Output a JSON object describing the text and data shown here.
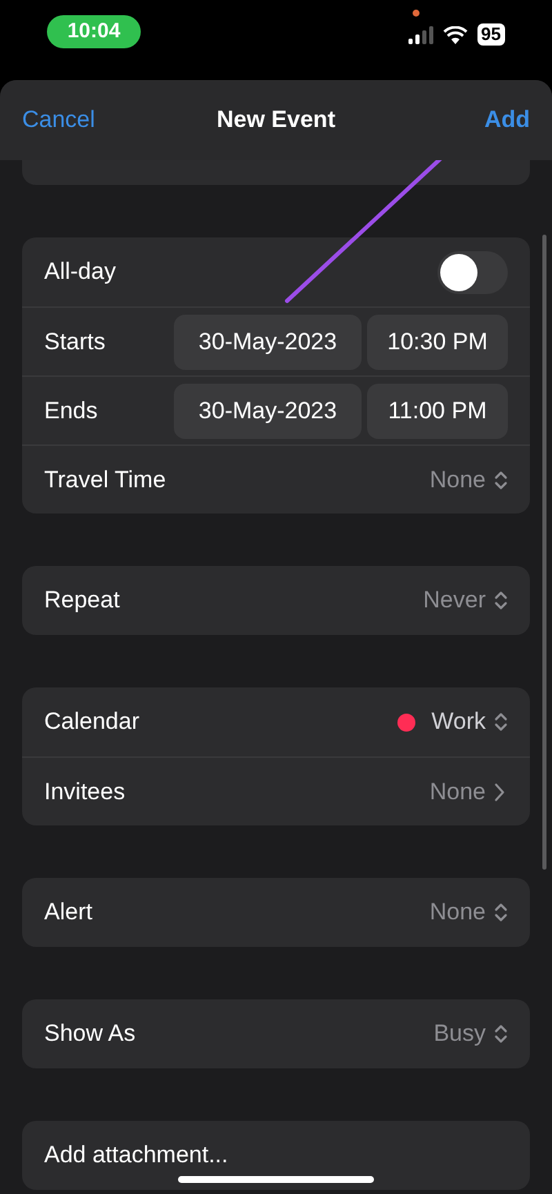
{
  "status_bar": {
    "time": "10:04",
    "battery": "95"
  },
  "header": {
    "cancel": "Cancel",
    "title": "New Event",
    "add": "Add"
  },
  "sections": [
    [
      {
        "kind": "toggle",
        "label": "All-day",
        "on": false
      },
      {
        "kind": "datetime",
        "label": "Starts",
        "date": "30-May-2023",
        "time": "10:30 PM"
      },
      {
        "kind": "datetime",
        "label": "Ends",
        "date": "30-May-2023",
        "time": "11:00 PM"
      },
      {
        "kind": "picker",
        "label": "Travel Time",
        "value": "None"
      }
    ],
    [
      {
        "kind": "picker",
        "label": "Repeat",
        "value": "Never"
      }
    ],
    [
      {
        "kind": "picker",
        "label": "Calendar",
        "value": "Work",
        "color": "#ff2d55"
      },
      {
        "kind": "link",
        "label": "Invitees",
        "value": "None"
      }
    ],
    [
      {
        "kind": "picker",
        "label": "Alert",
        "value": "None"
      }
    ],
    [
      {
        "kind": "picker",
        "label": "Show As",
        "value": "Busy"
      }
    ],
    [
      {
        "kind": "action",
        "label": "Add attachment..."
      }
    ]
  ]
}
